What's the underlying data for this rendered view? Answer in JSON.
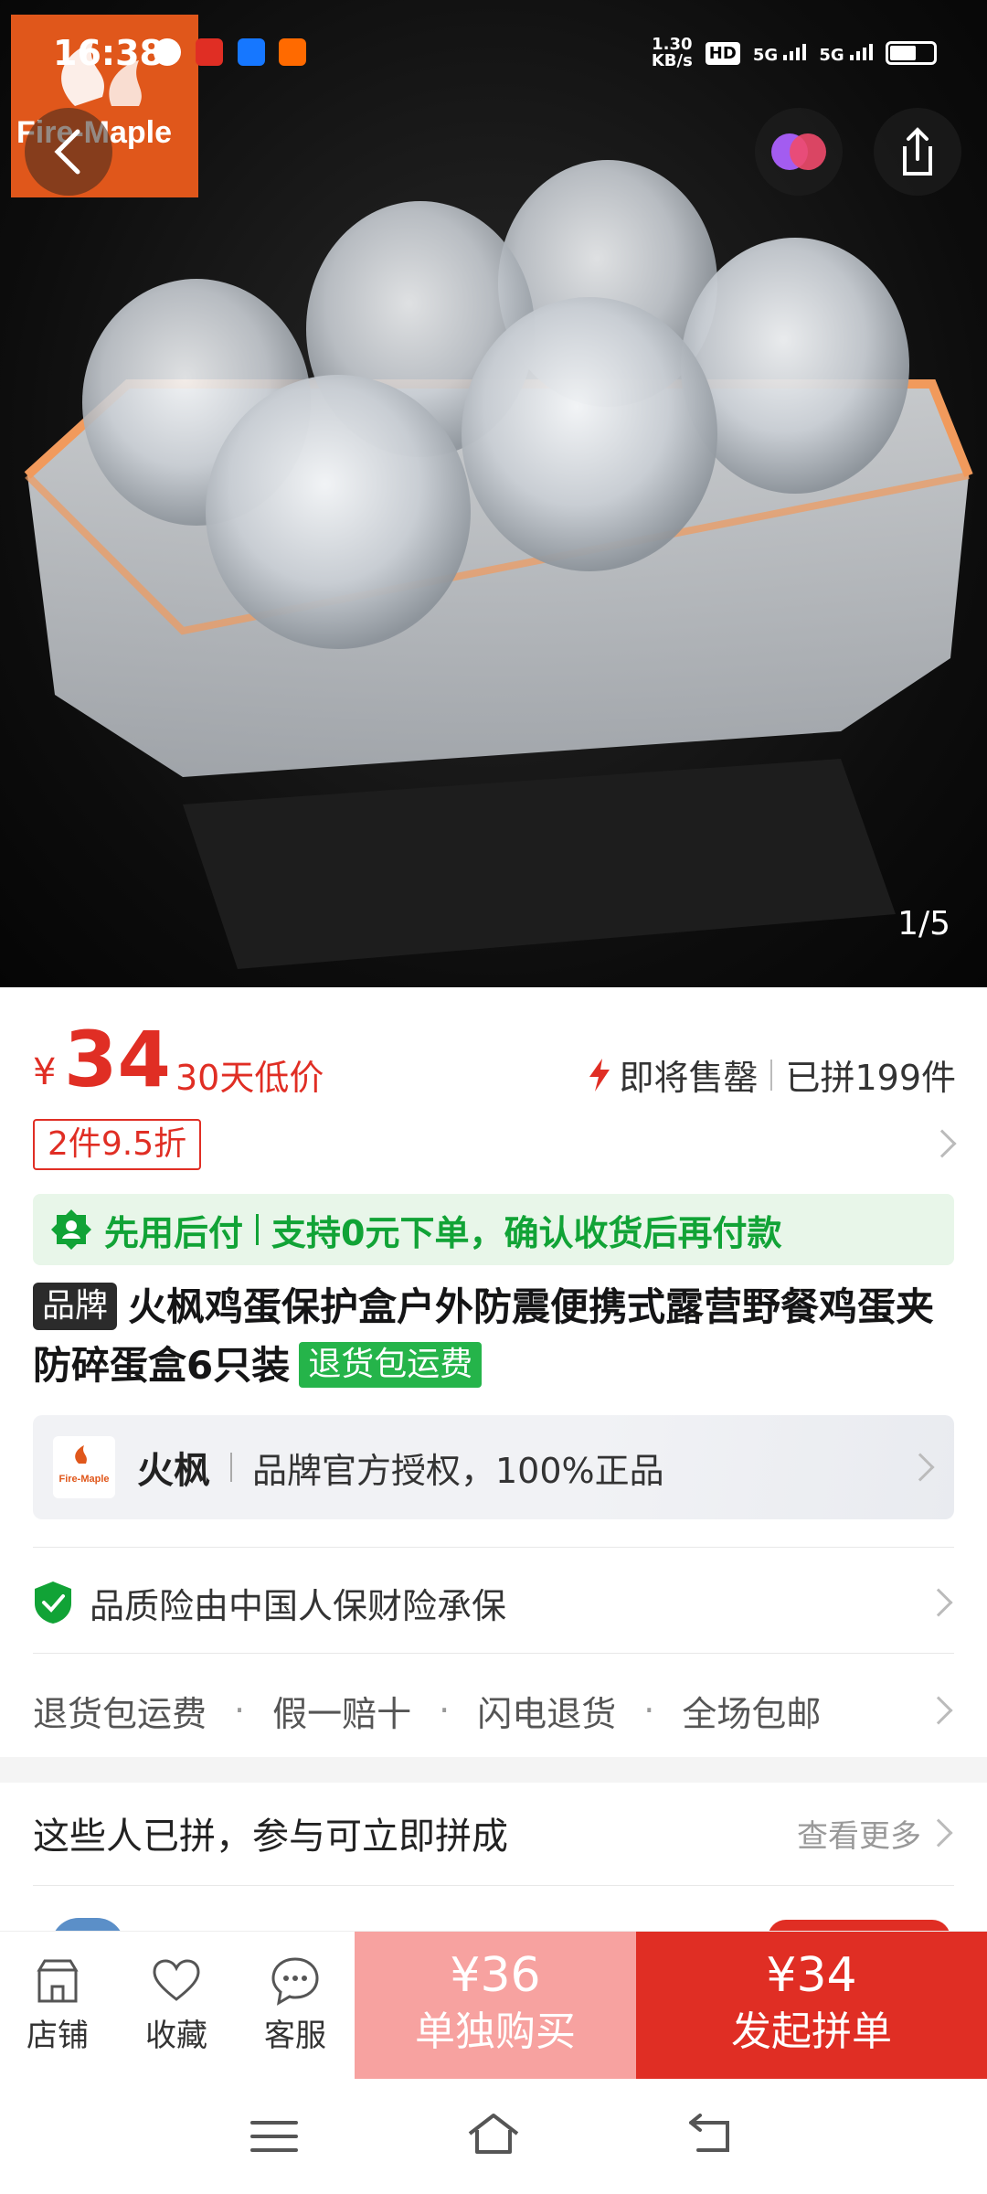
{
  "status_bar": {
    "time": "16:38",
    "net_speed": "1.30\nKB/s",
    "net_speed_value": "1.30",
    "net_speed_unit": "KB/s",
    "hd_label": "HD",
    "signal_1": "5G",
    "signal_2": "5G"
  },
  "hero": {
    "brand_logo_text": "Fire-Maple",
    "image_counter": "1/5"
  },
  "price": {
    "currency": "¥",
    "value": "34",
    "tag": "30天低价",
    "sale_status": "即将售罄",
    "sold_count": "已拼199件",
    "discount": "2件9.5折"
  },
  "pay_later": {
    "label": "先用后付",
    "desc": "支持0元下单，确认收货后再付款"
  },
  "product": {
    "brand_chip": "品牌",
    "title": "火枫鸡蛋保护盒户外防震便携式露营野餐鸡蛋夹防碎蛋盒6只装",
    "return_chip": "退货包运费"
  },
  "store": {
    "logo_text": "Fire-Maple",
    "name": "火枫",
    "desc": "品牌官方授权，100%正品"
  },
  "insurance": {
    "text": "品质险由中国人保财险承保"
  },
  "services": [
    "退货包运费",
    "假一赔十",
    "闪电退货",
    "全场包邮"
  ],
  "group_buy": {
    "title": "这些人已拼，参与可立即拼成",
    "more": "查看更多"
  },
  "bottom_bar": {
    "store_label": "店铺",
    "favorite_label": "收藏",
    "service_label": "客服",
    "solo_price": "¥36",
    "solo_label": "单独购买",
    "group_price": "¥34",
    "group_label": "发起拼单"
  },
  "colors": {
    "accent_red": "#e02e24",
    "solo_pink": "#f7a2a0",
    "paylater_green": "#11a336",
    "brand_orange": "#e0571b"
  }
}
